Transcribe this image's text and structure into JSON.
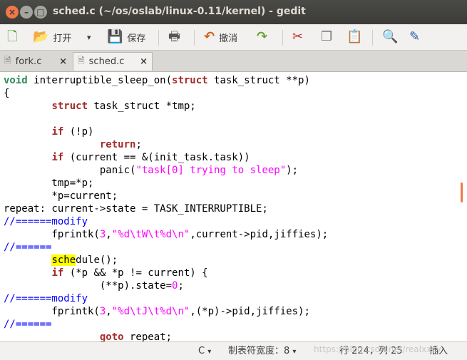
{
  "window": {
    "title": "sched.c (~/os/oslab/linux-0.11/kernel) - gedit",
    "close_icon": "×",
    "min_icon": "–",
    "max_icon": "□"
  },
  "toolbar": {
    "new_icon": "🗋",
    "open_label": "打开",
    "open_icon": "📂",
    "open_dropdown_icon": "▾",
    "save_label": "保存",
    "save_icon": "💾",
    "print_icon": "🖶",
    "undo_label": "撤消",
    "undo_icon": "↶",
    "redo_icon": "↷",
    "cut_icon": "✂",
    "copy_icon": "❐",
    "paste_icon": "📋",
    "find_icon": "🔍",
    "replace_icon": "✎"
  },
  "tabs": [
    {
      "label": "fork.c",
      "close": "×",
      "icon": "🗎"
    },
    {
      "label": "sched.c",
      "close": "×",
      "icon": "🗎"
    }
  ],
  "code": {
    "l1_type": "void",
    "l1_a": " interruptible_sleep_on(",
    "l1_kw": "struct",
    "l1_b": " task_struct **p)",
    "l2": "{",
    "l3_indent": "        ",
    "l3_kw": "struct",
    "l3_b": " task_struct *tmp;",
    "l4": "",
    "l5_indent": "        ",
    "l5_kw": "if",
    "l5_b": " (!p)",
    "l6_indent": "                ",
    "l6_kw": "return",
    "l6_b": ";",
    "l7_indent": "        ",
    "l7_kw": "if",
    "l7_b": " (current == &(init_task.task))",
    "l8_a": "                panic(",
    "l8_str": "\"task[0] trying to sleep\"",
    "l8_b": ");",
    "l9": "        tmp=*p;",
    "l10": "        *p=current;",
    "l11": "repeat: current->state = TASK_INTERRUPTIBLE;",
    "l12": "//======modify",
    "l13_a": "        fprintk(",
    "l13_num": "3",
    "l13_b": ",",
    "l13_str": "\"%d\\tW\\t%d\\n\"",
    "l13_c": ",current->pid,jiffies);",
    "l14": "//======",
    "l15_indent": "        ",
    "l15_hl": "sche",
    "l15_b": "dule();",
    "l16_indent": "        ",
    "l16_kw": "if",
    "l16_b": " (*p && *p != current) {",
    "l17_a": "                (**p).state=",
    "l17_num": "0",
    "l17_b": ";",
    "l18": "//======modify",
    "l19_a": "        fprintk(",
    "l19_num": "3",
    "l19_b": ",",
    "l19_str": "\"%d\\tJ\\t%d\\n\"",
    "l19_c": ",(*p)->pid,jiffies);",
    "l20": "//======",
    "l21_indent": "                ",
    "l21_kw": "goto",
    "l21_b": " repeat;"
  },
  "statusbar": {
    "language": "C",
    "dropdown_icon": "▾",
    "tab_width": "制表符宽度：8",
    "position": "行 224，列 25",
    "mode": "插入"
  },
  "watermark": "https://blog.csdn.net/realxxcy"
}
